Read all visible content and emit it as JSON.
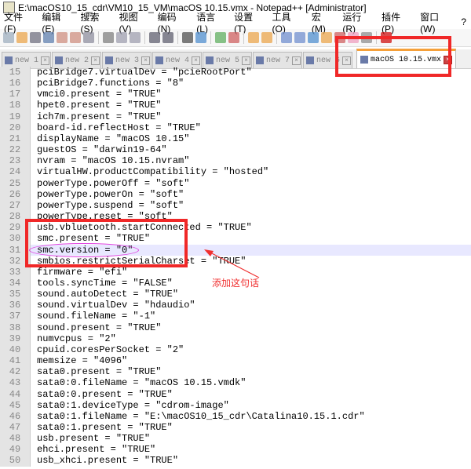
{
  "title": "E:\\macOS10_15_cdr\\VM10_15_VM\\macOS 10.15.vmx - Notepad++ [Administrator]",
  "menu": [
    "文件(F)",
    "编辑(E)",
    "搜索(S)",
    "视图(V)",
    "编码(N)",
    "语言(L)",
    "设置(T)",
    "工具(O)",
    "宏(M)",
    "运行(R)",
    "插件(P)",
    "窗口(W)",
    "?"
  ],
  "tabs": [
    "new 1",
    "new 2",
    "new 3",
    "new 4",
    "new 5",
    "new 7",
    "new 6"
  ],
  "active_tab": "macOS 10.15.vmx",
  "current_line": 31,
  "lines": [
    {
      "n": "15",
      "t": "pciBridge7.virtualDev = \"pcieRootPort\""
    },
    {
      "n": "16",
      "t": "pciBridge7.functions = \"8\""
    },
    {
      "n": "17",
      "t": "vmci0.present = \"TRUE\""
    },
    {
      "n": "18",
      "t": "hpet0.present = \"TRUE\""
    },
    {
      "n": "19",
      "t": "ich7m.present = \"TRUE\""
    },
    {
      "n": "20",
      "t": "board-id.reflectHost = \"TRUE\""
    },
    {
      "n": "21",
      "t": "displayName = \"macOS 10.15\""
    },
    {
      "n": "22",
      "t": "guestOS = \"darwin19-64\""
    },
    {
      "n": "23",
      "t": "nvram = \"macOS 10.15.nvram\""
    },
    {
      "n": "24",
      "t": "virtualHW.productCompatibility = \"hosted\""
    },
    {
      "n": "25",
      "t": "powerType.powerOff = \"soft\""
    },
    {
      "n": "26",
      "t": "powerType.powerOn = \"soft\""
    },
    {
      "n": "27",
      "t": "powerType.suspend = \"soft\""
    },
    {
      "n": "28",
      "t": "powerType.reset = \"soft\""
    },
    {
      "n": "29",
      "t": "usb.vbluetooth.startConnected = \"TRUE\""
    },
    {
      "n": "30",
      "t": "smc.present = \"TRUE\""
    },
    {
      "n": "31",
      "t": "smc.version = \"0\""
    },
    {
      "n": "32",
      "t": "smbios.restrictSerialCharset = \"TRUE\""
    },
    {
      "n": "33",
      "t": "firmware = \"efi\""
    },
    {
      "n": "34",
      "t": "tools.syncTime = \"FALSE\""
    },
    {
      "n": "35",
      "t": "sound.autoDetect = \"TRUE\""
    },
    {
      "n": "36",
      "t": "sound.virtualDev = \"hdaudio\""
    },
    {
      "n": "37",
      "t": "sound.fileName = \"-1\""
    },
    {
      "n": "38",
      "t": "sound.present = \"TRUE\""
    },
    {
      "n": "39",
      "t": "numvcpus = \"2\""
    },
    {
      "n": "40",
      "t": "cpuid.coresPerSocket = \"2\""
    },
    {
      "n": "41",
      "t": "memsize = \"4096\""
    },
    {
      "n": "42",
      "t": "sata0.present = \"TRUE\""
    },
    {
      "n": "43",
      "t": "sata0:0.fileName = \"macOS 10.15.vmdk\""
    },
    {
      "n": "44",
      "t": "sata0:0.present = \"TRUE\""
    },
    {
      "n": "45",
      "t": "sata0:1.deviceType = \"cdrom-image\""
    },
    {
      "n": "46",
      "t": "sata0:1.fileName = \"E:\\macOS10_15_cdr\\Catalina10.15.1.cdr\""
    },
    {
      "n": "47",
      "t": "sata0:1.present = \"TRUE\""
    },
    {
      "n": "48",
      "t": "usb.present = \"TRUE\""
    },
    {
      "n": "49",
      "t": "ehci.present = \"TRUE\""
    },
    {
      "n": "50",
      "t": "usb_xhci.present = \"TRUE\""
    }
  ],
  "annotation": "添加这句话",
  "annotation_color": "#f03030"
}
